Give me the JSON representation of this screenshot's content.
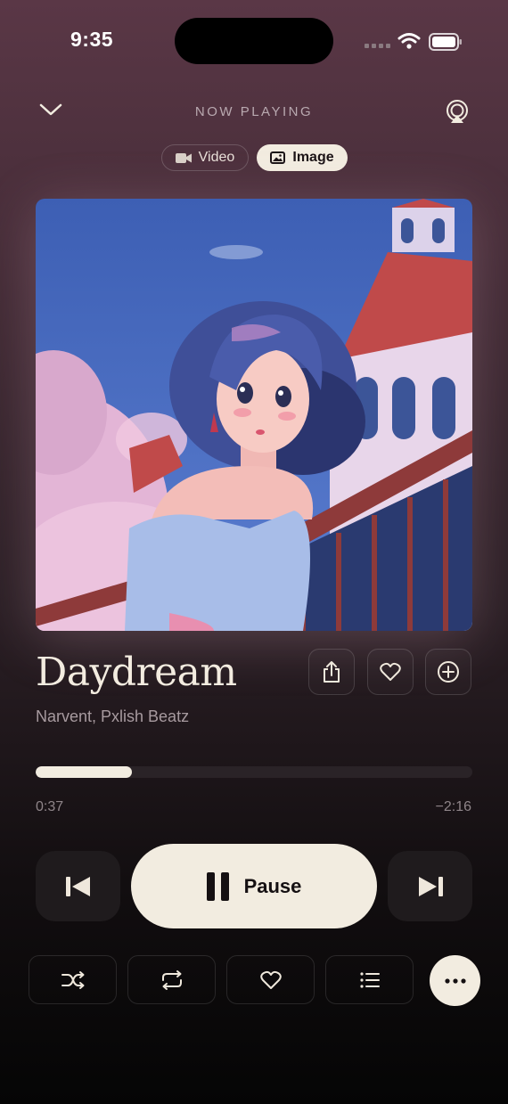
{
  "status_bar": {
    "time": "9:35"
  },
  "header": {
    "title": "NOW PLAYING"
  },
  "segments": [
    {
      "label": "Video",
      "icon": "video-camera-icon",
      "selected": false
    },
    {
      "label": "Image",
      "icon": "photo-icon",
      "selected": true
    }
  ],
  "track": {
    "title": "Daydream",
    "artist": "Narvent, Pxlish Beatz",
    "elapsed": "0:37",
    "remaining": "−2:16",
    "progress_fraction": 0.22
  },
  "controls": {
    "pause_label": "Pause"
  },
  "colors": {
    "accent": "#f2ece0",
    "background_top": "#5a3746",
    "background_bottom": "#050505"
  }
}
